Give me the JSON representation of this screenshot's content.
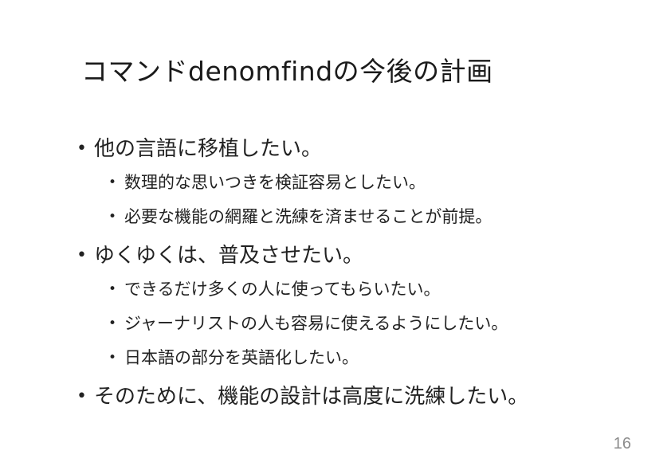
{
  "slide": {
    "title": "コマンドdenomfindの今後の計画",
    "page_number": "16",
    "bullet_symbol": "•",
    "groups": [
      {
        "text": "他の言語に移植したい。",
        "subitems": [
          "数理的な思いつきを検証容易としたい。",
          "必要な機能の網羅と洗練を済ませることが前提。"
        ]
      },
      {
        "text": "ゆくゆくは、普及させたい。",
        "subitems": [
          "できるだけ多くの人に使ってもらいたい。",
          "ジャーナリストの人も容易に使えるようにしたい。",
          "日本語の部分を英語化したい。"
        ]
      },
      {
        "text": "そのために、機能の設計は高度に洗練したい。",
        "subitems": []
      }
    ]
  }
}
